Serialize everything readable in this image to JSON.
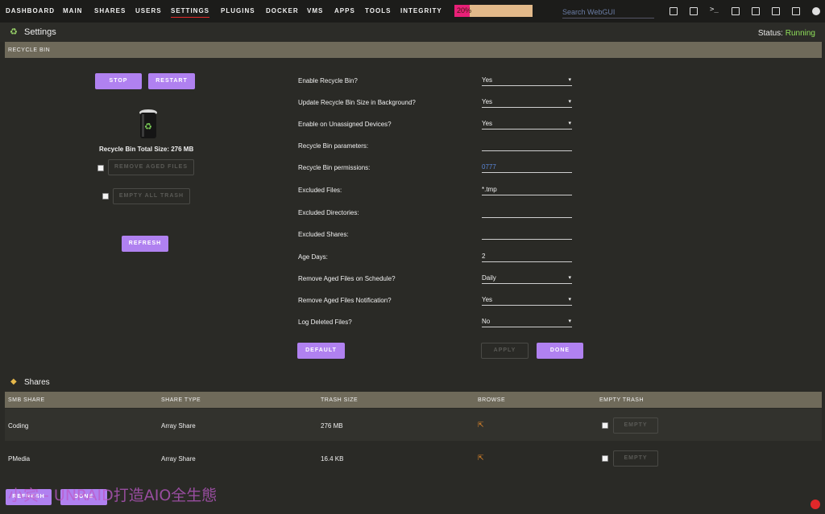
{
  "nav": {
    "items": [
      "DASHBOARD",
      "MAIN",
      "SHARES",
      "USERS",
      "SETTINGS",
      "PLUGINS",
      "DOCKER",
      "VMS",
      "APPS",
      "TOOLS",
      "INTEGRITY"
    ],
    "active": "SETTINGS",
    "progress_label": "20%",
    "progress_fraction": 0.2,
    "search_placeholder": "Search WebGUI",
    "icons": [
      "reload-icon",
      "logout-icon",
      "terminal-icon",
      "windows-icon",
      "feedback-icon",
      "monitor-icon",
      "notes-icon",
      "info-icon"
    ]
  },
  "header": {
    "title": "Settings",
    "status_label": "Status:",
    "status_value": "Running",
    "status_color": "#8fe05a"
  },
  "recycle": {
    "section_title": "RECYCLE BIN",
    "stop_label": "STOP",
    "restart_label": "RESTART",
    "total_size": "Recycle Bin Total Size: 276 MB",
    "remove_aged_label": "REMOVE AGED FILES",
    "empty_all_label": "EMPTY ALL TRASH",
    "refresh_label": "REFRESH",
    "settings": [
      {
        "label": "Enable Recycle Bin?",
        "value": "Yes",
        "select": true
      },
      {
        "label": "Update Recycle Bin Size in Background?",
        "value": "Yes",
        "select": true
      },
      {
        "label": "Enable on Unassigned Devices?",
        "value": "Yes",
        "select": true
      },
      {
        "label": "Recycle Bin parameters:",
        "value": "",
        "select": false
      },
      {
        "label": "Recycle Bin permissions:",
        "value": "0777",
        "select": false
      },
      {
        "label": "Excluded Files:",
        "value": "*.tmp",
        "select": false
      },
      {
        "label": "Excluded Directories:",
        "value": "",
        "select": false
      },
      {
        "label": "Excluded Shares:",
        "value": "",
        "select": false
      },
      {
        "label": "Age Days:",
        "value": "2",
        "select": false
      },
      {
        "label": "Remove Aged Files on Schedule?",
        "value": "Daily",
        "select": true
      },
      {
        "label": "Remove Aged Files Notification?",
        "value": "Yes",
        "select": true
      },
      {
        "label": "Log Deleted Files?",
        "value": "No",
        "select": true
      }
    ],
    "default_label": "DEFAULT",
    "apply_label": "APPLY",
    "done_label": "DONE"
  },
  "shares": {
    "title": "Shares",
    "columns": [
      "SMB SHARE",
      "SHARE TYPE",
      "TRASH SIZE",
      "BROWSE",
      "EMPTY TRASH"
    ],
    "rows": [
      {
        "name": "Coding",
        "type": "Array Share",
        "size": "276 MB",
        "empty_label": "EMPTY"
      },
      {
        "name": "PMedia",
        "type": "Array Share",
        "size": "16.4 KB",
        "empty_label": "EMPTY"
      }
    ],
    "refresh_label": "REFRESH",
    "done_label": "DONE"
  },
  "watermark": "小宾 - UNRAID打造AIO全生態"
}
